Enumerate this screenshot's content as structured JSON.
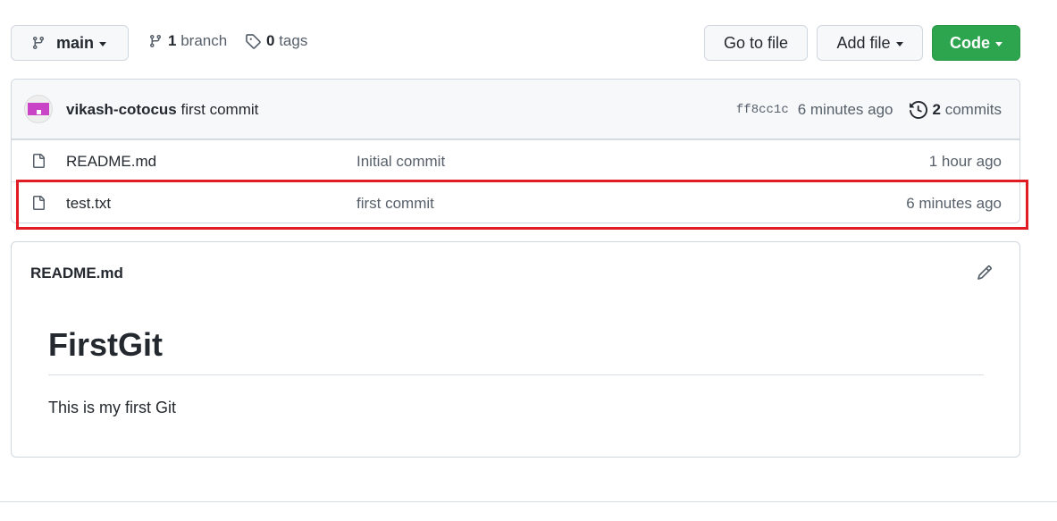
{
  "toolbar": {
    "branch": "main",
    "branch_count": "1",
    "branch_label": "branch",
    "tag_count": "0",
    "tag_label": "tags",
    "goto_file": "Go to file",
    "add_file": "Add file",
    "code": "Code"
  },
  "latest_commit": {
    "author": "vikash-cotocus",
    "message": "first commit",
    "sha": "ff8cc1c",
    "age": "6 minutes ago",
    "commit_count": "2",
    "commit_label": "commits"
  },
  "files": [
    {
      "name": "README.md",
      "message": "Initial commit",
      "age": "1 hour ago"
    },
    {
      "name": "test.txt",
      "message": "first commit",
      "age": "6 minutes ago"
    }
  ],
  "readme": {
    "title": "README.md",
    "heading": "FirstGit",
    "body": "This is my first Git"
  },
  "colors": {
    "code_button": "#2da44e",
    "highlight": "#e21c24"
  }
}
